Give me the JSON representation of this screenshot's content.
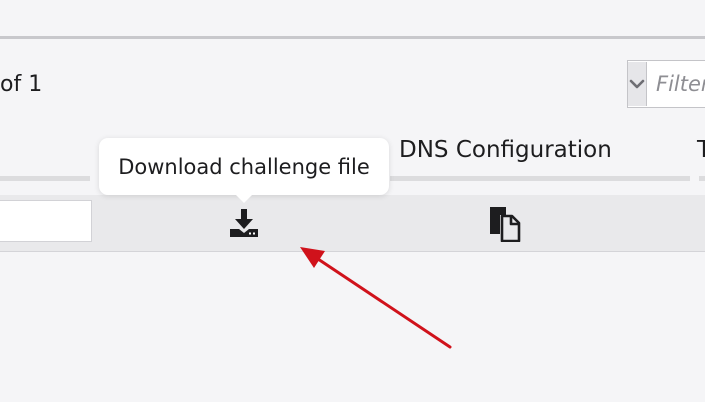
{
  "pagination": {
    "text": "of 1"
  },
  "filter": {
    "placeholder": "Filter",
    "dropdown_icon": "chevron-down-icon"
  },
  "columns": {
    "dns_configuration": "DNS Configuration",
    "next_column_partial": "T"
  },
  "row": {
    "download_icon": "download-icon",
    "copy_icon": "copy-icon"
  },
  "tooltip": {
    "text": "Download challenge file"
  },
  "colors": {
    "background": "#f5f5f7",
    "row_background": "#e9e9eb",
    "annotation_arrow": "#d0121b",
    "text": "#1d1d1f",
    "placeholder": "#8e8e93"
  }
}
